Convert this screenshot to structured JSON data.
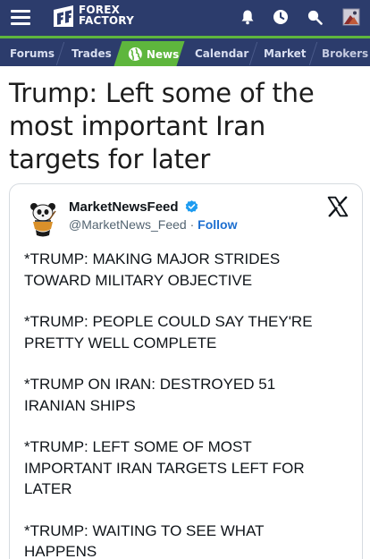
{
  "header": {
    "logo_line1": "FOREX",
    "logo_line2": "FACTORY",
    "icons": [
      "menu-icon",
      "bell-icon",
      "clock-icon",
      "search-icon",
      "profile-icon"
    ]
  },
  "nav": {
    "tabs": [
      {
        "label": "Forums",
        "active": false
      },
      {
        "label": "Trades",
        "active": false
      },
      {
        "label": "News",
        "active": true
      },
      {
        "label": "Calendar",
        "active": false
      },
      {
        "label": "Market",
        "active": false
      },
      {
        "label": "Brokers",
        "active": false
      }
    ]
  },
  "article": {
    "title_line1": "Trump: Left some of the",
    "title_line2": "most important Iran",
    "title_line3": "targets for later"
  },
  "tweet": {
    "account_name": "MarketNewsFeed",
    "handle": "@MarketNews_Feed",
    "separator": " · ",
    "follow_label": "Follow",
    "paragraphs": [
      {
        "line1": "*TRUMP: MAKING MAJOR STRIDES",
        "line2": "TOWARD MILITARY OBJECTIVE"
      },
      {
        "line1": "*TRUMP: PEOPLE COULD SAY THEY'RE",
        "line2": "PRETTY WELL COMPLETE"
      },
      {
        "line1": "*TRUMP ON IRAN: DESTROYED 51",
        "line2": "IRANIAN SHIPS"
      },
      {
        "line1": "*TRUMP: LEFT SOME OF MOST",
        "line2": "IMPORTANT IRAN TARGETS LEFT FOR",
        "line3": "LATER"
      },
      {
        "line1": "*TRUMP: WAITING TO SEE WHAT",
        "line2": "HAPPENS"
      }
    ]
  },
  "colors": {
    "header_bg": "#2c3c6c",
    "accent_green": "#5eb63d",
    "follow_blue": "#1d6fd0",
    "verified_blue": "#1d9bf0"
  }
}
